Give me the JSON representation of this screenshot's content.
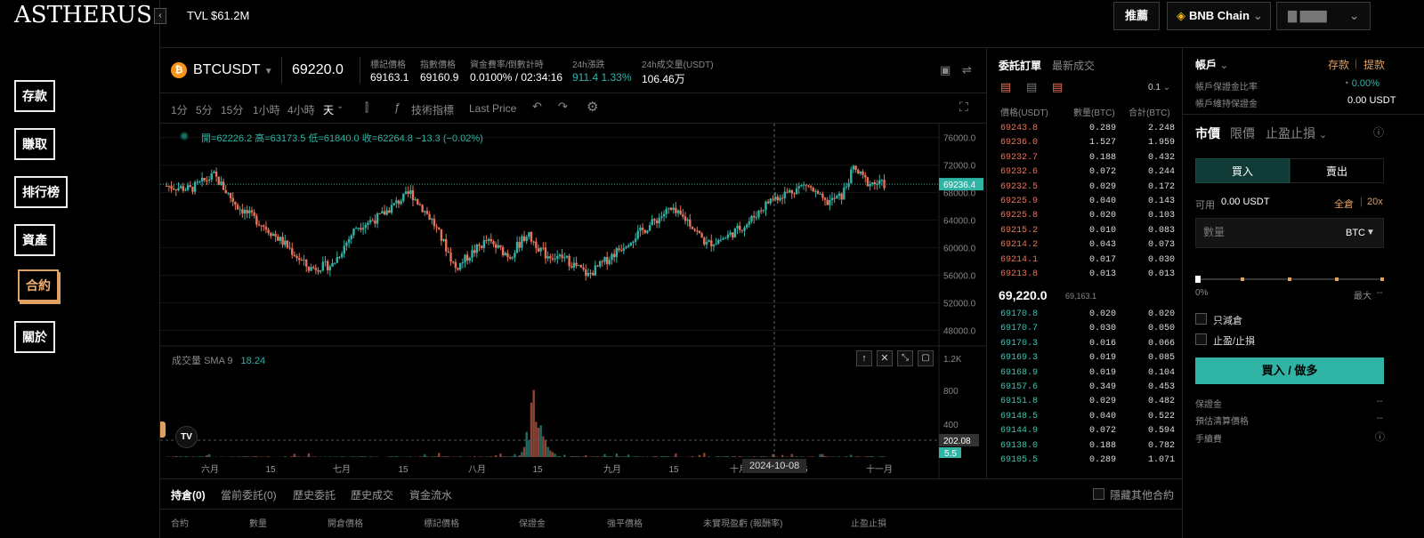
{
  "brand": {
    "logo": "ASTHERUS",
    "tvl": "TVL $61.2M"
  },
  "nav": {
    "items": [
      {
        "label": "存款"
      },
      {
        "label": "賺取"
      },
      {
        "label": "排行榜"
      },
      {
        "label": "資產"
      },
      {
        "label": "合約"
      },
      {
        "label": "關於"
      }
    ],
    "active": "合約"
  },
  "header": {
    "recommend": "推薦",
    "chain": "BNB Chain",
    "wallet": "▇ ▇▇▇"
  },
  "ticker": {
    "symbol": "BTCUSDT",
    "last": "69220.0",
    "stats": [
      {
        "label": "標記價格",
        "value": "69163.1"
      },
      {
        "label": "指數價格",
        "value": "69160.9"
      },
      {
        "label": "資金費率/倒數計時",
        "value": "0.0100% / 02:34:16"
      },
      {
        "label": "24h漲跌",
        "value": "911.4 1.33%"
      },
      {
        "label": "24h成交量(USDT)",
        "value": "106.46万"
      }
    ]
  },
  "toolbar": {
    "timeframes": [
      "1分",
      "5分",
      "15分",
      "1小時",
      "4小時",
      "天"
    ],
    "active_tf": "天",
    "indicators": "技術指標",
    "price_mode": "Last Price"
  },
  "chart": {
    "ohlc": "開=62226.2  高=63173.5  低=61840.0  收=62264.8  −13.3 (−0.02%)",
    "yticks": [
      "76000.0",
      "72000.0",
      "68000.0",
      "64000.0",
      "60000.0",
      "56000.0",
      "52000.0",
      "48000.0"
    ],
    "price_tag": "69236.4",
    "vol_label": "成交量",
    "vol_sma": "SMA 9",
    "vol_value": "18.24",
    "vol_yticks": [
      "1.2K",
      "800",
      "400"
    ],
    "vol_tag": "202.08",
    "vol_tag2": "5.5",
    "xticks": [
      "六月",
      "15",
      "七月",
      "15",
      "八月",
      "15",
      "九月",
      "15",
      "十月",
      "15",
      "十一月"
    ],
    "cross_date": "2024-10-08"
  },
  "chart_data": {
    "type": "candlestick",
    "xlabel": "",
    "ylabel": "",
    "ylim": [
      46000,
      77000
    ],
    "last_price": 69236.4,
    "crosshair_date": "2024-10-08",
    "crosshair_ohlc": {
      "open": 62226.2,
      "high": 63173.5,
      "low": 61840.0,
      "close": 62264.8
    },
    "volume_sma9": 18.24
  },
  "orderbook": {
    "tabs": [
      "委託訂單",
      "最新成交"
    ],
    "precision": "0.1",
    "headers": [
      "價格(USDT)",
      "數量(BTC)",
      "合計(BTC)"
    ],
    "asks": [
      [
        "69243.8",
        "0.289",
        "2.248"
      ],
      [
        "69236.0",
        "1.527",
        "1.959"
      ],
      [
        "69232.7",
        "0.188",
        "0.432"
      ],
      [
        "69232.6",
        "0.072",
        "0.244"
      ],
      [
        "69232.5",
        "0.029",
        "0.172"
      ],
      [
        "69225.9",
        "0.040",
        "0.143"
      ],
      [
        "69225.8",
        "0.020",
        "0.103"
      ],
      [
        "69215.2",
        "0.010",
        "0.083"
      ],
      [
        "69214.2",
        "0.043",
        "0.073"
      ],
      [
        "69214.1",
        "0.017",
        "0.030"
      ],
      [
        "69213.8",
        "0.013",
        "0.013"
      ]
    ],
    "mid": "69,220.0",
    "mid_mark": "69,163.1",
    "bids": [
      [
        "69170.8",
        "0.020",
        "0.020"
      ],
      [
        "69170.7",
        "0.030",
        "0.050"
      ],
      [
        "69170.3",
        "0.016",
        "0.066"
      ],
      [
        "69169.3",
        "0.019",
        "0.085"
      ],
      [
        "69168.9",
        "0.019",
        "0.104"
      ],
      [
        "69157.6",
        "0.349",
        "0.453"
      ],
      [
        "69151.8",
        "0.029",
        "0.482"
      ],
      [
        "69148.5",
        "0.040",
        "0.522"
      ],
      [
        "69144.9",
        "0.072",
        "0.594"
      ],
      [
        "69138.0",
        "0.188",
        "0.782"
      ],
      [
        "69105.5",
        "0.289",
        "1.071"
      ]
    ]
  },
  "account": {
    "title": "帳戶",
    "deposit": "存款",
    "withdraw": "提款",
    "margin_ratio_label": "帳戶保證金比率",
    "margin_ratio": "0.00%",
    "maint_label": "帳戶維持保證金",
    "maint": "0.00 USDT",
    "order_types": [
      "市價",
      "限價",
      "止盈止損"
    ],
    "buy": "買入",
    "sell": "賣出",
    "avail_label": "可用",
    "avail": "0.00 USDT",
    "cross": "全倉",
    "lev": "20x",
    "qty_placeholder": "數量",
    "qty_unit": "BTC",
    "slider_min": "0%",
    "slider_max": "最大",
    "slider_max_val": "--",
    "slider_value": 0,
    "reduce_only": "只減倉",
    "tpsl": "止盈/止損",
    "submit": "買入 / 做多",
    "fields": [
      {
        "label": "保證金",
        "value": "--"
      },
      {
        "label": "預估清算價格",
        "value": "--"
      },
      {
        "label": "手續費",
        "value": ""
      }
    ]
  },
  "positions": {
    "tabs": [
      "持倉(0)",
      "當前委託(0)",
      "歷史委託",
      "歷史成交",
      "資金流水"
    ],
    "hide_others": "隱藏其他合約",
    "columns": [
      "合約",
      "數量",
      "開倉價格",
      "標記價格",
      "保證金",
      "強平價格",
      "未實現盈虧 (報酬率)",
      "止盈止損"
    ]
  },
  "colors": {
    "up": "#2fb4a6",
    "down": "#e8735a",
    "accent": "#e0a060",
    "bg": "#000000"
  }
}
